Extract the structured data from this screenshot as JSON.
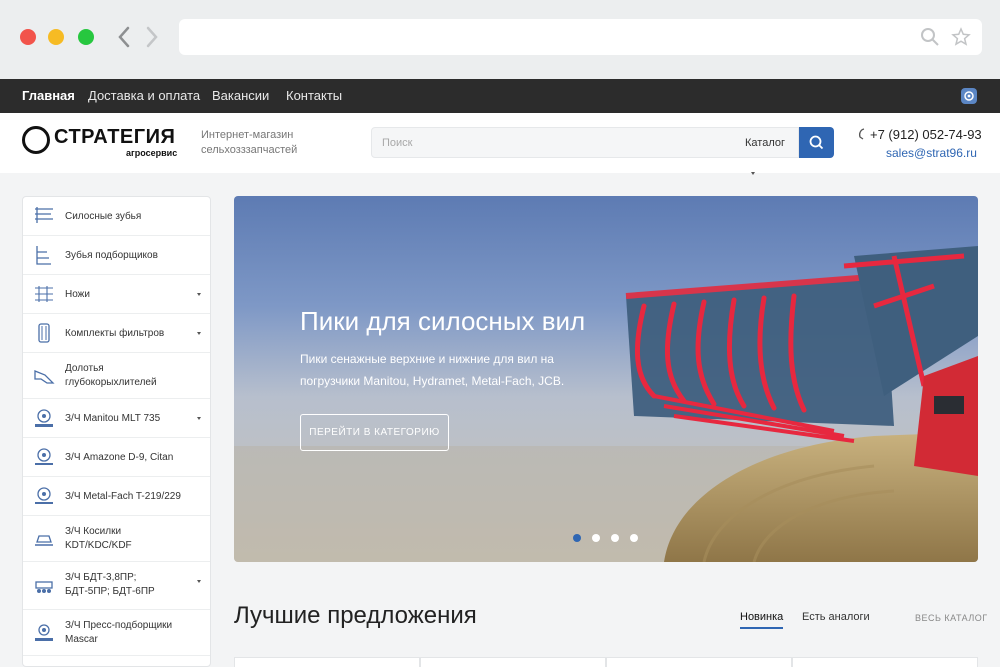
{
  "browser": {
    "icons": [
      "back-icon",
      "forward-icon",
      "search-icon",
      "star-icon"
    ]
  },
  "topnav": {
    "items": [
      {
        "label": "Главная"
      },
      {
        "label": "Доставка и оплата"
      },
      {
        "label": "Вакансии"
      },
      {
        "label": "Контакты"
      }
    ]
  },
  "header": {
    "logo": {
      "word": "СТРАТЕГИЯ",
      "sub": "агросервис"
    },
    "tagline": "Интернет-магазин сельхозззапчастей",
    "search": {
      "placeholder": "Поиск",
      "catalog_label": "Каталог"
    },
    "phone": "+7 (912) 052-74-93",
    "email": "sales@strat96.ru"
  },
  "sidebar": {
    "items": [
      {
        "label": "Силосные зубья",
        "icon": "tines-icon"
      },
      {
        "label": "Зубья подборщиков",
        "icon": "pickup-teeth-icon"
      },
      {
        "label": "Ножи",
        "icon": "blades-icon"
      },
      {
        "label": "Комплекты фильтров",
        "icon": "filter-icon"
      },
      {
        "label": "Долотья глубокорыхлителей",
        "icon": "chisel-icon"
      },
      {
        "label": "З/Ч Manitou MLT 735",
        "icon": "manitou-icon"
      },
      {
        "label": "З/Ч Amazone D-9, Citan",
        "icon": "amazone-icon"
      },
      {
        "label": "З/Ч Metal-Fach T-219/229",
        "icon": "metal-fach-icon"
      },
      {
        "label": "З/Ч Косилки KDT/KDC/KDF",
        "icon": "mower-icon"
      },
      {
        "label": "З/Ч БДТ-3,8ПР; БДТ-5ПР; БДТ-6ПР",
        "icon": "harrow-icon"
      },
      {
        "label": "З/Ч Пресс-подборщики Mascar",
        "icon": "mascar-icon"
      }
    ]
  },
  "banner": {
    "title": "Пики для силосных вил",
    "description": "Пики сенажные верхние и нижние для вил на погрузчики Manitou, Hydramet, Metal-Fach, JCB.",
    "button_label": "ПЕРЕЙТИ В КАТЕГОРИЮ",
    "slides_total": 4,
    "active_slide": 1
  },
  "best_offers": {
    "title": "Лучшие предложения",
    "tabs": [
      {
        "label": "Новинка"
      },
      {
        "label": "Есть аналоги"
      }
    ],
    "all_catalog": "ВЕСЬ КАТАЛОГ"
  },
  "colors": {
    "accent": "#2f66b3",
    "nav_bg": "#2c2c2c"
  }
}
